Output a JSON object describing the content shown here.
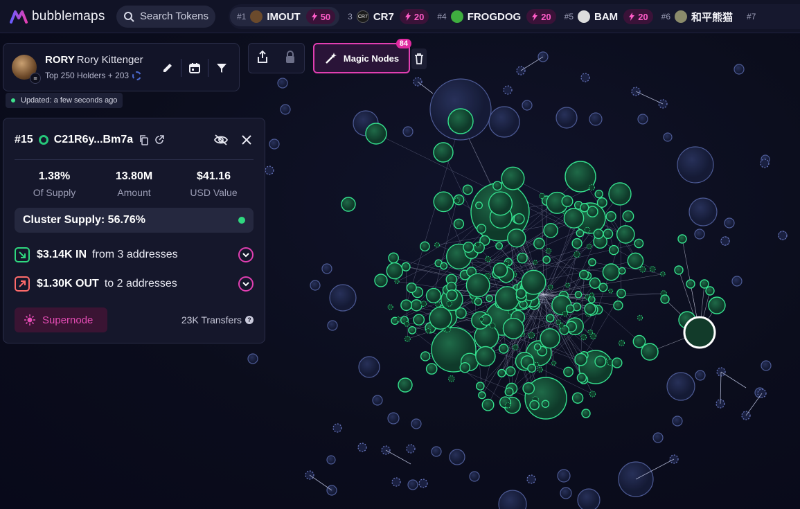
{
  "brand": {
    "name": "bubblemaps"
  },
  "search": {
    "placeholder": "Search Tokens"
  },
  "ticker": [
    {
      "rank": "#1",
      "name": "IMOUT",
      "count": "50",
      "avatar_color": "#6b4a2c"
    },
    {
      "rank": "",
      "name": "CR7",
      "count": "20",
      "avatar_color": "#1a1a1a"
    },
    {
      "rank": "#4",
      "name": "FROGDOG",
      "count": "20",
      "avatar_color": "#3fae3f"
    },
    {
      "rank": "#5",
      "name": "BAM",
      "count": "20",
      "avatar_color": "#dddddd"
    },
    {
      "rank": "#6",
      "name": "和平熊猫",
      "count": "",
      "avatar_color": "#8b8b6b"
    },
    {
      "rank": "#7",
      "name": "",
      "count": "",
      "avatar_color": ""
    }
  ],
  "token": {
    "symbol": "RORY",
    "name": "Rory Kittenger",
    "subtitle": "Top 250 Holders + 203"
  },
  "updated": {
    "text": "Updated: a few seconds ago"
  },
  "magic_nodes": {
    "label": "Magic Nodes",
    "count": "84"
  },
  "address": {
    "rank": "#15",
    "addr": "C21R6y...Bm7a",
    "stats": [
      {
        "value": "1.38%",
        "label": "Of Supply"
      },
      {
        "value": "13.80M",
        "label": "Amount"
      },
      {
        "value": "$41.16",
        "label": "USD Value"
      }
    ],
    "cluster_supply": "Cluster Supply: 56.76%",
    "inflow": {
      "amount": "$3.14K IN",
      "text": "from 3 addresses"
    },
    "outflow": {
      "amount": "$1.30K OUT",
      "text": "to 2 addresses"
    },
    "supernode": "Supernode",
    "transfers": "23K Transfers"
  },
  "colors": {
    "accent": "#e23fb2",
    "cluster_green": "#2fd87f",
    "bubble_blue": "#2b3560",
    "background": "#0b0d1c"
  }
}
